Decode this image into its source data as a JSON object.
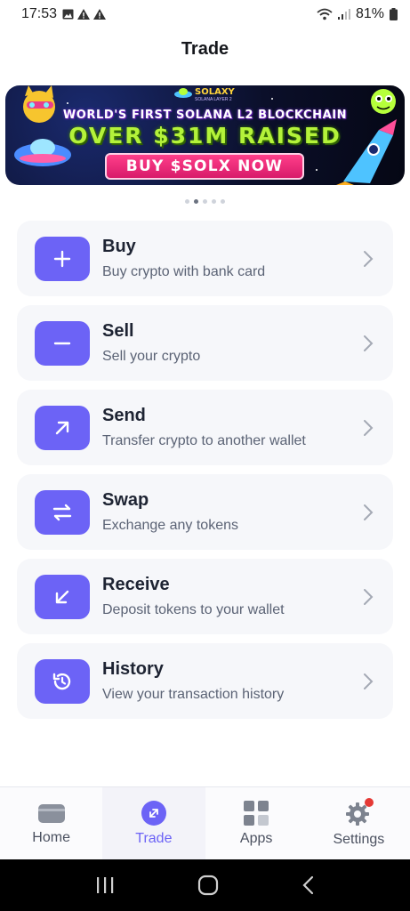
{
  "status_bar": {
    "time": "17:53",
    "notification_icons": [
      "image-icon",
      "warning-icon",
      "warning-icon"
    ],
    "battery": "81%"
  },
  "header": {
    "title": "Trade"
  },
  "banner": {
    "logo_text": "SOLAXY",
    "logo_sub": "SOLANA LAYER 2",
    "line1": "WORLD'S FIRST SOLANA L2 BLOCKCHAIN",
    "line2": "OVER $31M RAISED",
    "cta": "BUY $SOLX NOW"
  },
  "pager": {
    "count": 5,
    "active_index": 1
  },
  "menu": {
    "items": [
      {
        "title": "Buy",
        "subtitle": "Buy crypto with bank card",
        "icon": "plus-icon"
      },
      {
        "title": "Sell",
        "subtitle": "Sell your crypto",
        "icon": "minus-icon"
      },
      {
        "title": "Send",
        "subtitle": "Transfer crypto to another wallet",
        "icon": "arrow-up-right-icon"
      },
      {
        "title": "Swap",
        "subtitle": "Exchange any tokens",
        "icon": "swap-icon"
      },
      {
        "title": "Receive",
        "subtitle": "Deposit tokens to your wallet",
        "icon": "arrow-down-left-icon"
      },
      {
        "title": "History",
        "subtitle": "View your transaction history",
        "icon": "history-icon"
      }
    ]
  },
  "bottom_nav": {
    "items": [
      {
        "label": "Home",
        "icon": "wallet-icon",
        "active": false
      },
      {
        "label": "Trade",
        "icon": "trade-icon",
        "active": true
      },
      {
        "label": "Apps",
        "icon": "apps-grid-icon",
        "active": false
      },
      {
        "label": "Settings",
        "icon": "gear-icon",
        "active": false
      }
    ]
  },
  "colors": {
    "accent": "#6c63f6",
    "card_bg": "#f6f7fa",
    "notification_dot": "#e53935"
  }
}
